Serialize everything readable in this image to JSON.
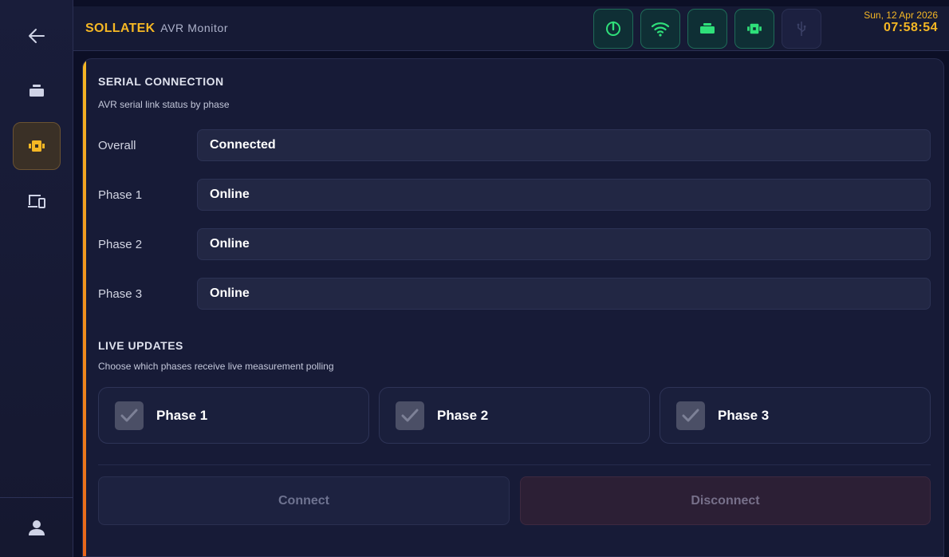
{
  "header": {
    "brand": "SOLLATEK",
    "brand_sub": "AVR Monitor",
    "date": "Sun, 12 Apr 2026",
    "time": "07:58:54"
  },
  "status_icons": [
    "power-icon",
    "wifi-icon",
    "battery-icon",
    "serial-icon",
    "usb-icon"
  ],
  "sidebar": {
    "items": [
      "back-arrow-icon",
      "battery-icon",
      "serial-icon",
      "devices-icon"
    ],
    "active_item": "serial-icon",
    "footer_item": "user-icon"
  },
  "serial": {
    "title": "SERIAL CONNECTION",
    "subtitle": "AVR serial link status by phase",
    "rows": [
      {
        "label": "Overall",
        "value": "Connected"
      },
      {
        "label": "Phase 1",
        "value": "Online"
      },
      {
        "label": "Phase 2",
        "value": "Online"
      },
      {
        "label": "Phase 3",
        "value": "Online"
      }
    ]
  },
  "live": {
    "title": "LIVE UPDATES",
    "subtitle": "Choose which phases receive live measurement polling",
    "phases": [
      {
        "label": "Phase 1",
        "checked": true
      },
      {
        "label": "Phase 2",
        "checked": true
      },
      {
        "label": "Phase 3",
        "checked": true
      }
    ]
  },
  "actions": {
    "connect": "Connect",
    "disconnect": "Disconnect"
  },
  "colors": {
    "accent": "#f5b724",
    "status_green": "#2fe07a",
    "background": "#0c0f26"
  }
}
